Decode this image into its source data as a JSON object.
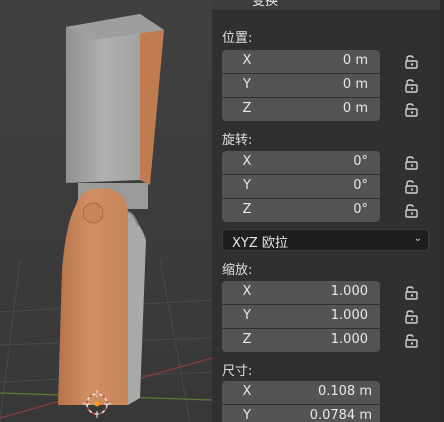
{
  "panel": {
    "header_title": "变换",
    "header_menu_icon": "ellipsis-icon",
    "location": {
      "label": "位置:",
      "rows": [
        {
          "axis": "X",
          "value": "0 m"
        },
        {
          "axis": "Y",
          "value": "0 m"
        },
        {
          "axis": "Z",
          "value": "0 m"
        }
      ]
    },
    "rotation": {
      "label": "旋转:",
      "rows": [
        {
          "axis": "X",
          "value": "0°"
        },
        {
          "axis": "Y",
          "value": "0°"
        },
        {
          "axis": "Z",
          "value": "0°"
        }
      ],
      "mode": "XYZ 欧拉"
    },
    "scale": {
      "label": "缩放:",
      "rows": [
        {
          "axis": "X",
          "value": "1.000"
        },
        {
          "axis": "Y",
          "value": "1.000"
        },
        {
          "axis": "Z",
          "value": "1.000"
        }
      ]
    },
    "dimensions": {
      "label": "尺寸:",
      "rows": [
        {
          "axis": "X",
          "value": "0.108 m"
        },
        {
          "axis": "Y",
          "value": "0.0784 m"
        }
      ]
    }
  },
  "colors": {
    "field_bg": "#545454",
    "panel_bg": "#303030",
    "object_orange": "#c88456",
    "object_gray": "#a9aaa8"
  }
}
